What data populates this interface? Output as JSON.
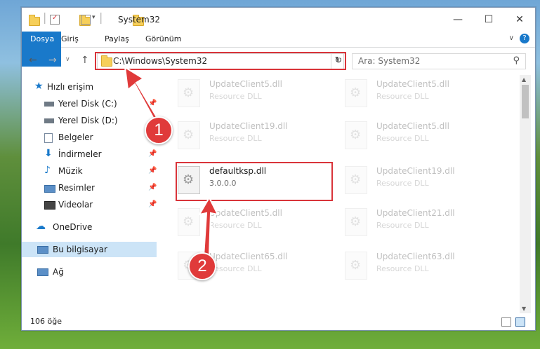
{
  "window": {
    "title": "System32"
  },
  "ribbon": {
    "tabs": [
      "Dosya",
      "Giriş",
      "Paylaş",
      "Görünüm"
    ]
  },
  "address": {
    "path": "C:\\Windows\\System32"
  },
  "search": {
    "placeholder": "Ara: System32"
  },
  "nav": {
    "items": [
      {
        "label": "Hızlı erişim",
        "icon": "star-icon"
      },
      {
        "label": "Yerel Disk (C:)",
        "icon": "drive-icon"
      },
      {
        "label": "Yerel Disk (D:)",
        "icon": "drive-icon"
      },
      {
        "label": "Belgeler",
        "icon": "documents-icon"
      },
      {
        "label": "İndirmeler",
        "icon": "download-icon"
      },
      {
        "label": "Müzik",
        "icon": "music-icon"
      },
      {
        "label": "Resimler",
        "icon": "pictures-icon"
      },
      {
        "label": "Videolar",
        "icon": "video-icon"
      },
      {
        "label": "OneDrive",
        "icon": "cloud-icon"
      },
      {
        "label": "Bu bilgisayar",
        "icon": "computer-icon"
      },
      {
        "label": "Ağ",
        "icon": "network-icon"
      }
    ]
  },
  "files": [
    {
      "name": "UpdateClient5.dll",
      "type": "Resource DLL"
    },
    {
      "name": "UpdateClient5.dll",
      "type": "Resource DLL"
    },
    {
      "name": "UpdateClient19.dll",
      "type": "Resource DLL"
    },
    {
      "name": "UpdateClient5.dll",
      "type": "Resource DLL"
    },
    {
      "name": "defaultksp.dll",
      "type": "3.0.0.0"
    },
    {
      "name": "UpdateClient19.dll",
      "type": "Resource DLL"
    },
    {
      "name": "UpdateClient5.dll",
      "type": "Resource DLL"
    },
    {
      "name": "UpdateClient21.dll",
      "type": "Resource DLL"
    },
    {
      "name": "UpdateClient65.dll",
      "type": "Resource DLL"
    },
    {
      "name": "UpdateClient63.dll",
      "type": "Resource DLL"
    }
  ],
  "status": {
    "count": "106 öğe"
  },
  "annotations": {
    "step1": "1",
    "step2": "2"
  },
  "colors": {
    "accent": "#1979ca",
    "highlight": "#d9343a"
  }
}
